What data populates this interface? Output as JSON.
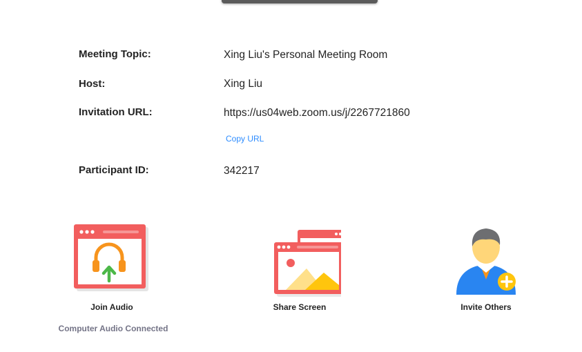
{
  "meeting_info": {
    "topic_label": "Meeting Topic:",
    "topic_value": "Xing Liu's Personal Meeting Room",
    "host_label": "Host:",
    "host_value": "Xing Liu",
    "url_label": "Invitation URL:",
    "url_value": "https://us04web.zoom.us/j/2267721860",
    "copy_url": "Copy URL",
    "participant_label": "Participant ID:",
    "participant_value": "342217"
  },
  "actions": {
    "join_audio": "Join Audio",
    "share_screen": "Share Screen",
    "invite_others": "Invite Others"
  },
  "audio_status": "Computer Audio Connected",
  "colors": {
    "window_red": "#f25e5e",
    "headphone_orange": "#f7941d",
    "arrow_green": "#4cb848",
    "image_yellow": "#ffc50d",
    "user_blue": "#2d8cff",
    "link_blue": "#2d8cff"
  }
}
